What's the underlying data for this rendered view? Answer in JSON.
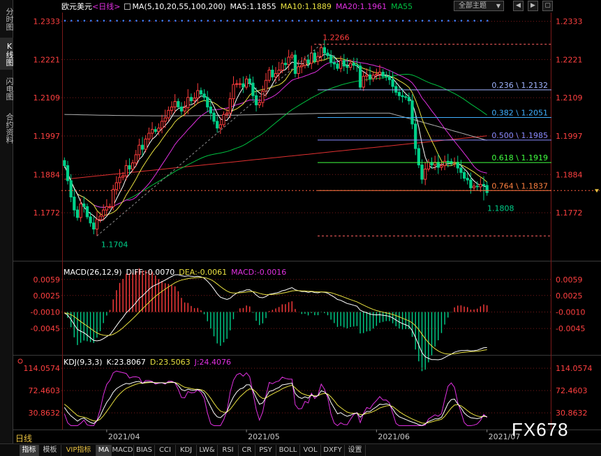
{
  "sidebar": {
    "tabs": [
      "分时图",
      "K线图",
      "闪电图",
      "合约资料"
    ],
    "active": "K线图"
  },
  "topbar": {
    "symbol": "欧元美元",
    "period": "<日线>",
    "ma_title": "MA(5,10,20,55,100,200)",
    "ma5": "MA5:1.1855",
    "ma10": "MA10:1.1889",
    "ma20": "MA20:1.1961",
    "ma55": "MA55",
    "theme_button": "全部主题",
    "theme_arrow": "▼",
    "win_buttons": [
      "◀",
      "▶",
      "▢"
    ]
  },
  "macd_header": {
    "title": "MACD(26,12,9)",
    "diff": "DIFF:-0.0070",
    "dea": "DEA:-0.0061",
    "macd": "MACD:-0.0016"
  },
  "kdj_header": {
    "title": "KDJ(9,3,3)",
    "k": "K:23.8067",
    "d": "D:23.5063",
    "j": "J:24.4076"
  },
  "bottom_tabs": [
    "指标",
    "模板",
    "VIP指标",
    "MA",
    "MACD",
    "BIAS",
    "CCI",
    "KDJ",
    "LW&",
    "RSI",
    "CR",
    "PSY",
    "BOLL",
    "VOL",
    "DXFY",
    "设置"
  ],
  "period_label": "日线",
  "watermark": "FX678",
  "colors": {
    "up": "#ff3c3c",
    "down": "#00d08a",
    "ma5": "#ffffff",
    "ma10": "#e8e040",
    "ma20": "#e030e0",
    "ma55": "#00c040",
    "ma100": "#b0b0b0",
    "ma200": "#e03030",
    "fib_236": "#a0b4ff",
    "fib_382": "#40b0ff",
    "fib_500": "#8a8cff",
    "fib_618": "#40ff40",
    "fib_764": "#ff8040",
    "axis_text": "#ff4040",
    "grid": "#7a1a1a"
  },
  "chart_data": {
    "type": "candlestick",
    "symbol": "欧元美元",
    "period": "日线",
    "price_axis": {
      "ticks": [
        "1.2333",
        "1.2221",
        "1.2109",
        "1.1997",
        "1.1884",
        "1.1772"
      ],
      "tick_values": [
        1.2333,
        1.2221,
        1.2109,
        1.1997,
        1.1884,
        1.1772
      ],
      "range": [
        1.167,
        1.2375
      ]
    },
    "x_axis": {
      "labels": [
        "2021/04",
        "2021/05",
        "2021/06",
        "2021/07"
      ],
      "label_index": [
        13,
        56,
        96,
        130
      ]
    },
    "annotations": {
      "high": {
        "label": "1.2266",
        "value": 1.2266,
        "index": 79
      },
      "low1": {
        "label": "1.1704",
        "value": 1.1704,
        "index": 10
      },
      "low2": {
        "label": "1.1808",
        "value": 1.1808,
        "index": 129
      }
    },
    "fibonacci": [
      {
        "label": "0.236 \\ 1.2132",
        "ratio": 0.236,
        "value": 1.2132
      },
      {
        "label": "0.382 \\ 1.2051",
        "ratio": 0.382,
        "value": 1.2051
      },
      {
        "label": "0.500 \\ 1.1985",
        "ratio": 0.5,
        "value": 1.1985
      },
      {
        "label": "0.618 \\ 1.1919",
        "ratio": 0.618,
        "value": 1.1919
      },
      {
        "label": "0.764 \\ 1.1837",
        "ratio": 0.764,
        "value": 1.1837
      }
    ],
    "last_price": 1.1837,
    "macd": {
      "ticks": [
        "0.0059",
        "0.0025",
        "-0.0010",
        "-0.0045"
      ],
      "tick_values": [
        0.0059,
        0.0025,
        -0.001,
        -0.0045
      ],
      "range": [
        -0.0095,
        0.0072
      ],
      "diff_last": -0.007,
      "dea_last": -0.0061,
      "macd_last": -0.0016
    },
    "kdj": {
      "ticks": [
        "114.0574",
        "72.4603",
        "30.8632"
      ],
      "tick_values": [
        114.0574,
        72.4603,
        30.8632
      ],
      "range": [
        5,
        122
      ],
      "k_last": 23.8067,
      "d_last": 23.5063,
      "j_last": 24.4076
    },
    "closes": [
      1.191,
      1.1866,
      1.1818,
      1.178,
      1.1758,
      1.1798,
      1.179,
      1.176,
      1.1742,
      1.1724,
      1.1752,
      1.1762,
      1.178,
      1.179,
      1.179,
      1.184,
      1.186,
      1.1876,
      1.188,
      1.191,
      1.19,
      1.1918,
      1.1942,
      1.197,
      1.1958,
      1.1988,
      1.2005,
      1.2016,
      1.201,
      1.202,
      1.204,
      1.205,
      1.2072,
      1.2082,
      1.2098,
      1.2082,
      1.207,
      1.208,
      1.211,
      1.21,
      1.2108,
      1.213,
      1.212,
      1.211,
      1.2082,
      1.2064,
      1.204,
      1.202,
      1.203,
      1.206,
      1.2064,
      1.2106,
      1.2148,
      1.215,
      1.215,
      1.214,
      1.2164,
      1.2152,
      1.2115,
      1.2088,
      1.2095,
      1.2128,
      1.216,
      1.219,
      1.217,
      1.218,
      1.219,
      1.221,
      1.2206,
      1.2228,
      1.2234,
      1.218,
      1.22,
      1.2204,
      1.222,
      1.221,
      1.224,
      1.2216,
      1.223,
      1.2256,
      1.224,
      1.2232,
      1.2212,
      1.2208,
      1.2195,
      1.2218,
      1.2202,
      1.2198,
      1.221,
      1.2204,
      1.2202,
      1.214,
      1.2172,
      1.2176,
      1.2165,
      1.2175,
      1.2178,
      1.2184,
      1.2172,
      1.217,
      1.2162,
      1.2142,
      1.2125,
      1.2115,
      1.2112,
      1.211,
      1.21,
      1.2032,
      1.196,
      1.1912,
      1.187,
      1.19,
      1.192,
      1.1912,
      1.192,
      1.1905,
      1.191,
      1.1923,
      1.1922,
      1.1917,
      1.192,
      1.1903,
      1.189,
      1.1873,
      1.1868,
      1.1845,
      1.185,
      1.1848,
      1.1855,
      1.1852,
      1.1831
    ]
  }
}
